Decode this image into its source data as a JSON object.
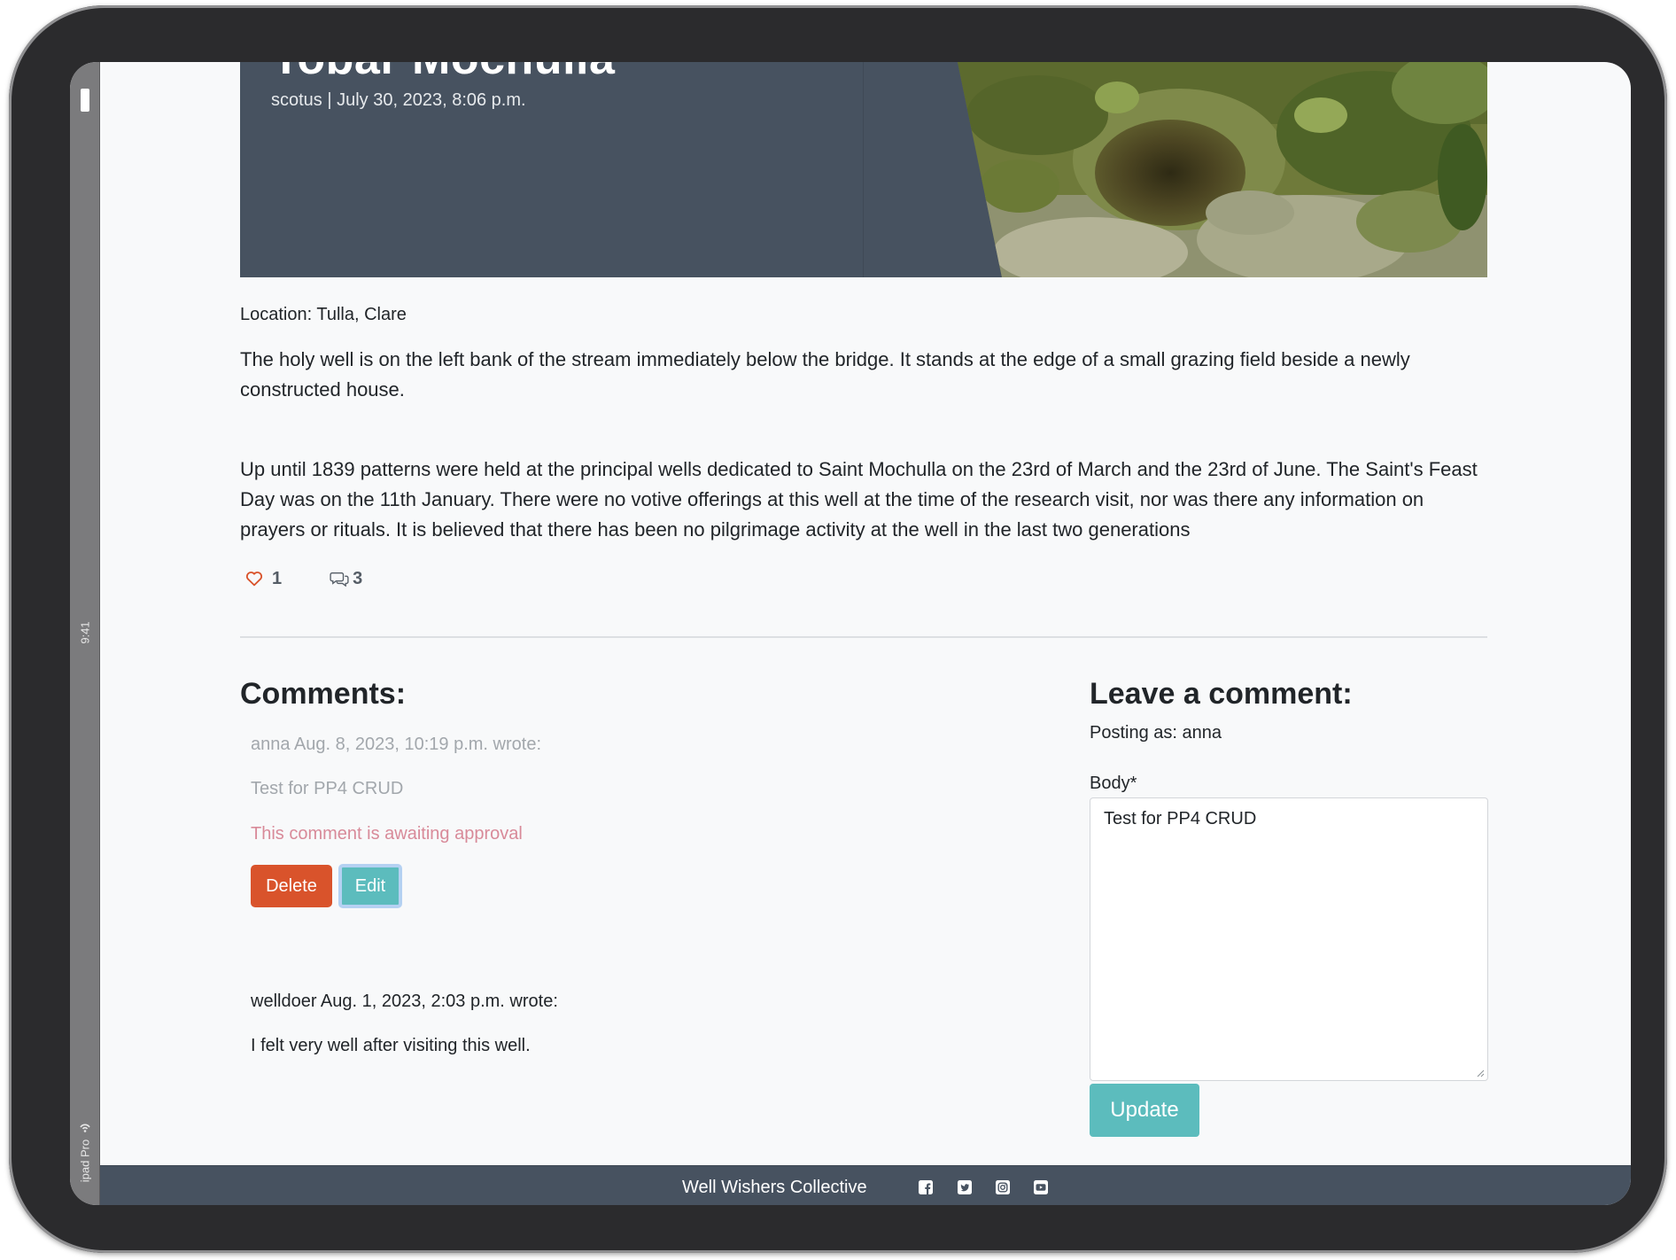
{
  "device": {
    "time": "9:41",
    "model": "ipad Pro"
  },
  "post": {
    "title": "Tobar Mochulla",
    "meta": "scotus | July 30, 2023, 8:06 p.m.",
    "location": "Location: Tulla, Clare",
    "paragraphs": [
      "The holy well is on the left bank of the stream immediately below the bridge. It stands at the edge of a small grazing field beside a newly constructed house.",
      "Up until 1839 patterns were held at the principal wells dedicated to Saint Mochulla on the 23rd of March and the 23rd of June. The Saint's Feast Day was on the 11th January. There were no votive offerings at this well at the time of the research visit, nor was there any information on prayers or rituals. It is believed that there has been no pilgrimage activity at the well in the last two generations"
    ],
    "likes": "1",
    "comment_count": "3"
  },
  "comments": {
    "heading": "Comments:",
    "items": [
      {
        "header": "anna Aug. 8, 2023, 10:19 p.m. wrote:",
        "body": "Test for PP4 CRUD",
        "status": "This comment is awaiting approval",
        "delete_label": "Delete",
        "edit_label": "Edit"
      },
      {
        "header": "welldoer Aug. 1, 2023, 2:03 p.m. wrote:",
        "body": "I felt very well after visiting this well."
      }
    ]
  },
  "form": {
    "heading": "Leave a comment:",
    "posting_as": "Posting as: anna",
    "body_label": "Body*",
    "body_value": "Test for PP4 CRUD",
    "submit_label": "Update"
  },
  "footer": {
    "brand": "Well Wishers Collective",
    "social_icons": [
      "facebook-icon",
      "twitter-icon",
      "instagram-icon",
      "youtube-icon"
    ]
  },
  "colors": {
    "hero_bg": "#475260",
    "delete": "#d9532b",
    "accent": "#5cbcbd",
    "pending": "#d88a99",
    "heart": "#d9532b"
  }
}
